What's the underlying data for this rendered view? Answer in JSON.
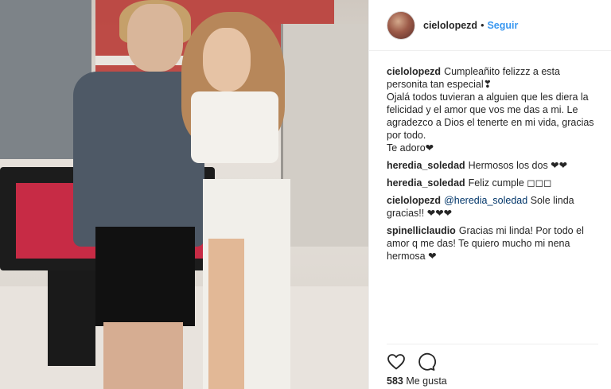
{
  "post": {
    "author": "cielolopezd",
    "follow_label": "Seguir",
    "separator": "•"
  },
  "comments": [
    {
      "user": "cielolopezd",
      "text": "Cumpleañito felizzz a esta personita tan especial❣\nOjalá todos tuvieran a alguien que les diera la felicidad y el amor que vos me das a mi. Le agradezco a Dios el tenerte en mi vida, gracias por todo.\nTe adoro❤"
    },
    {
      "user": "heredia_soledad",
      "text": "Hermosos los dos ❤❤"
    },
    {
      "user": "heredia_soledad",
      "text": "Feliz cumple ◻◻◻"
    },
    {
      "user": "cielolopezd",
      "mention": "@heredia_soledad",
      "text": " Sole linda gracias!! ❤❤❤"
    },
    {
      "user": "spinelliclaudio",
      "text": "Gracias mi linda! Por todo el amor q me das! Te quiero mucho mi nena hermosa ❤"
    }
  ],
  "actions": {
    "like_icon": "heart-icon",
    "comment_icon": "comment-bubble-icon"
  },
  "likes": {
    "count": "583",
    "label": "Me gusta"
  }
}
